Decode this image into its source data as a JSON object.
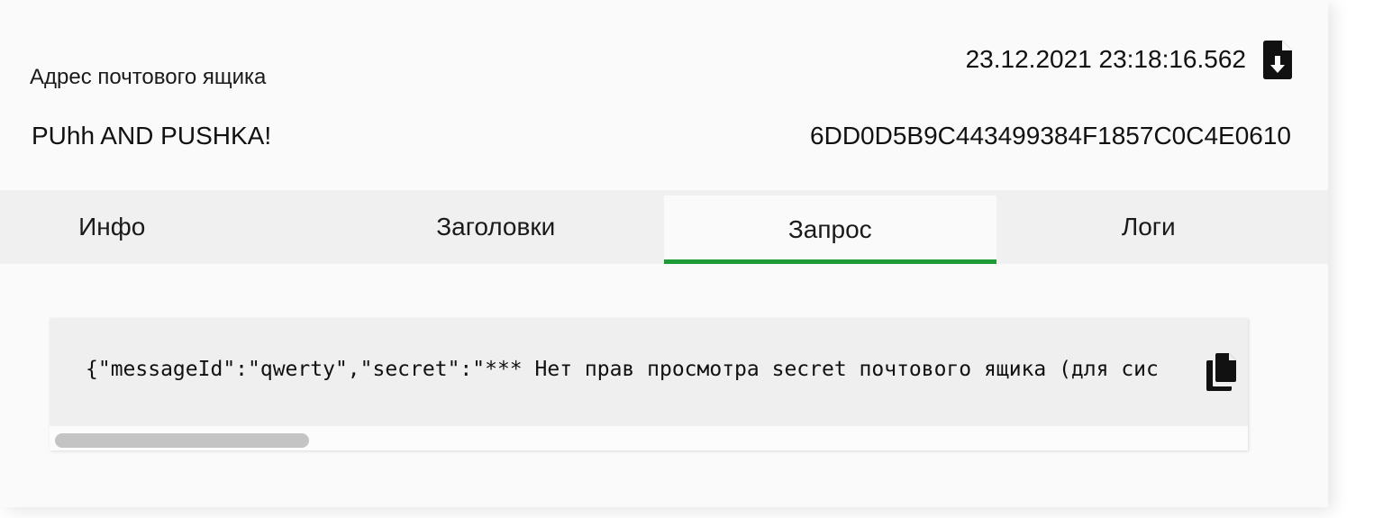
{
  "header": {
    "mailbox_label": "Адрес почтового ящика",
    "mailbox_name": "PUhh AND PUSHKA!",
    "timestamp": "23.12.2021 23:18:16.562",
    "message_id": "6DD0D5B9C443499384F1857C0C4E0610",
    "download_icon": "file-download-icon"
  },
  "tabs": [
    {
      "label": "Инфо",
      "active": false
    },
    {
      "label": "Заголовки",
      "active": false
    },
    {
      "label": "Запрос",
      "active": true
    },
    {
      "label": "Логи",
      "active": false
    }
  ],
  "request": {
    "body": "{\"messageId\":\"qwerty\",\"secret\":\"*** Нет прав просмотра secret почтового ящика (для сис",
    "copy_icon": "copy-icon"
  },
  "colors": {
    "active_tab_underline": "#1e9b36",
    "tabs_background": "#f0f0f0",
    "code_background": "#efefef"
  }
}
